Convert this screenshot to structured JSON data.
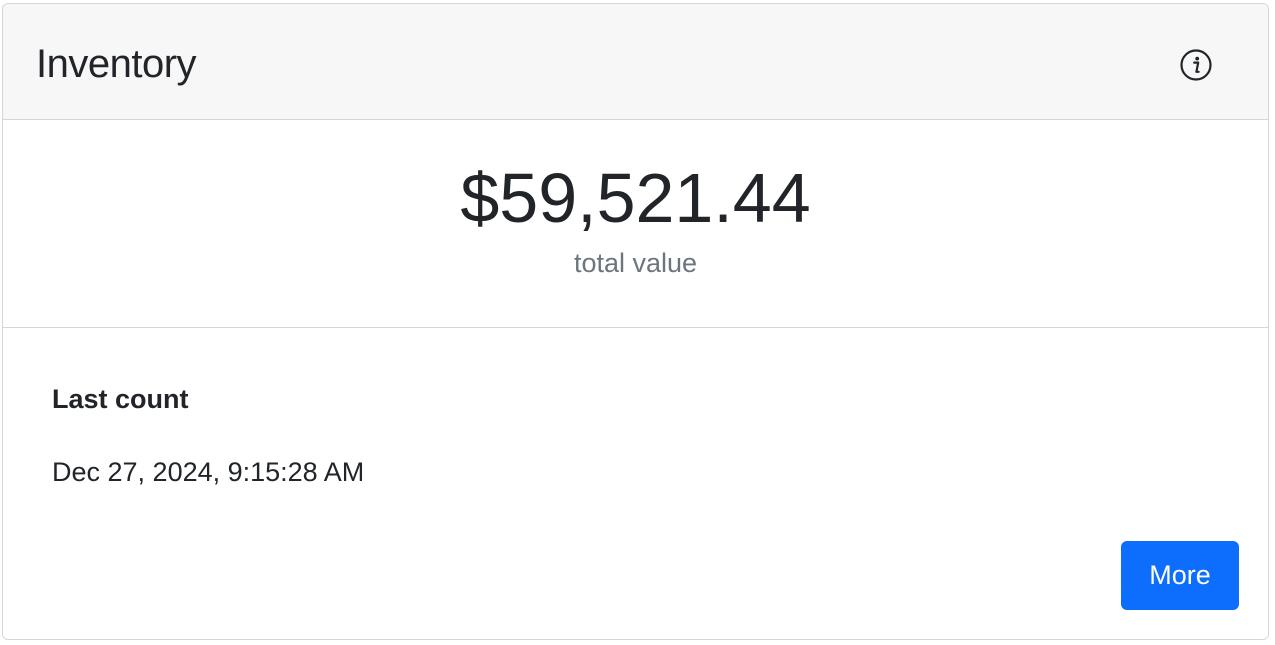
{
  "card": {
    "title": "Inventory",
    "info_icon": "info-circle-icon"
  },
  "stat": {
    "value": "$59,521.44",
    "label": "total value"
  },
  "details": {
    "heading": "Last count",
    "value": "Dec 27, 2024, 9:15:28 AM"
  },
  "actions": {
    "more_label": "More"
  },
  "colors": {
    "primary": "#0d6efd",
    "header_bg": "#f7f7f7",
    "muted_text": "#6c757d",
    "border": "#d6d6d6",
    "text": "#212529"
  }
}
